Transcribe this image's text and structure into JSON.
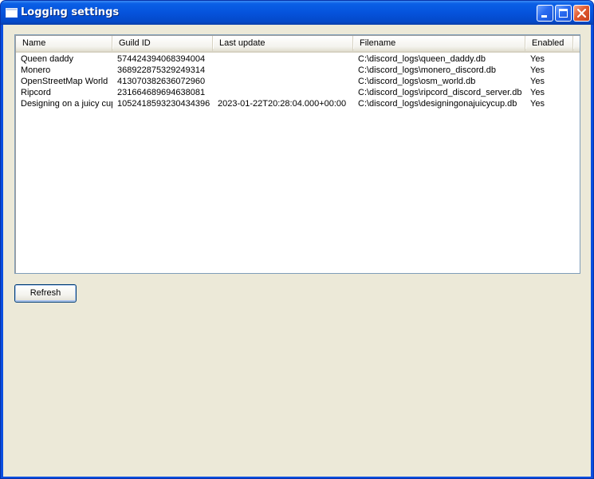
{
  "window": {
    "title": "Logging settings"
  },
  "listview": {
    "columns": [
      "Name",
      "Guild ID",
      "Last update",
      "Filename",
      "Enabled"
    ],
    "rows": [
      [
        "Queen daddy",
        "574424394068394004",
        "",
        "C:\\discord_logs\\queen_daddy.db",
        "Yes"
      ],
      [
        "Monero",
        "368922875329249314",
        "",
        "C:\\discord_logs\\monero_discord.db",
        "Yes"
      ],
      [
        "OpenStreetMap World",
        "413070382636072960",
        "",
        "C:\\discord_logs\\osm_world.db",
        "Yes"
      ],
      [
        "Ripcord",
        "231664689694638081",
        "",
        "C:\\discord_logs\\ripcord_discord_server.db",
        "Yes"
      ],
      [
        "Designing on a juicy cup",
        "1052418593230434396",
        "2023-01-22T20:28:04.000+00:00",
        "C:\\discord_logs\\designingonajuicycup.db",
        "Yes"
      ]
    ]
  },
  "buttons": {
    "refresh_label": "Refresh"
  },
  "colors": {
    "titlebar": "#0553dc",
    "client_bg": "#ece9d8",
    "list_border": "#7f9db9",
    "close_button": "#e05a30"
  },
  "icons": {
    "window_icon": "window-icon",
    "minimize": "minimize-icon",
    "maximize": "maximize-icon",
    "close": "close-icon"
  }
}
